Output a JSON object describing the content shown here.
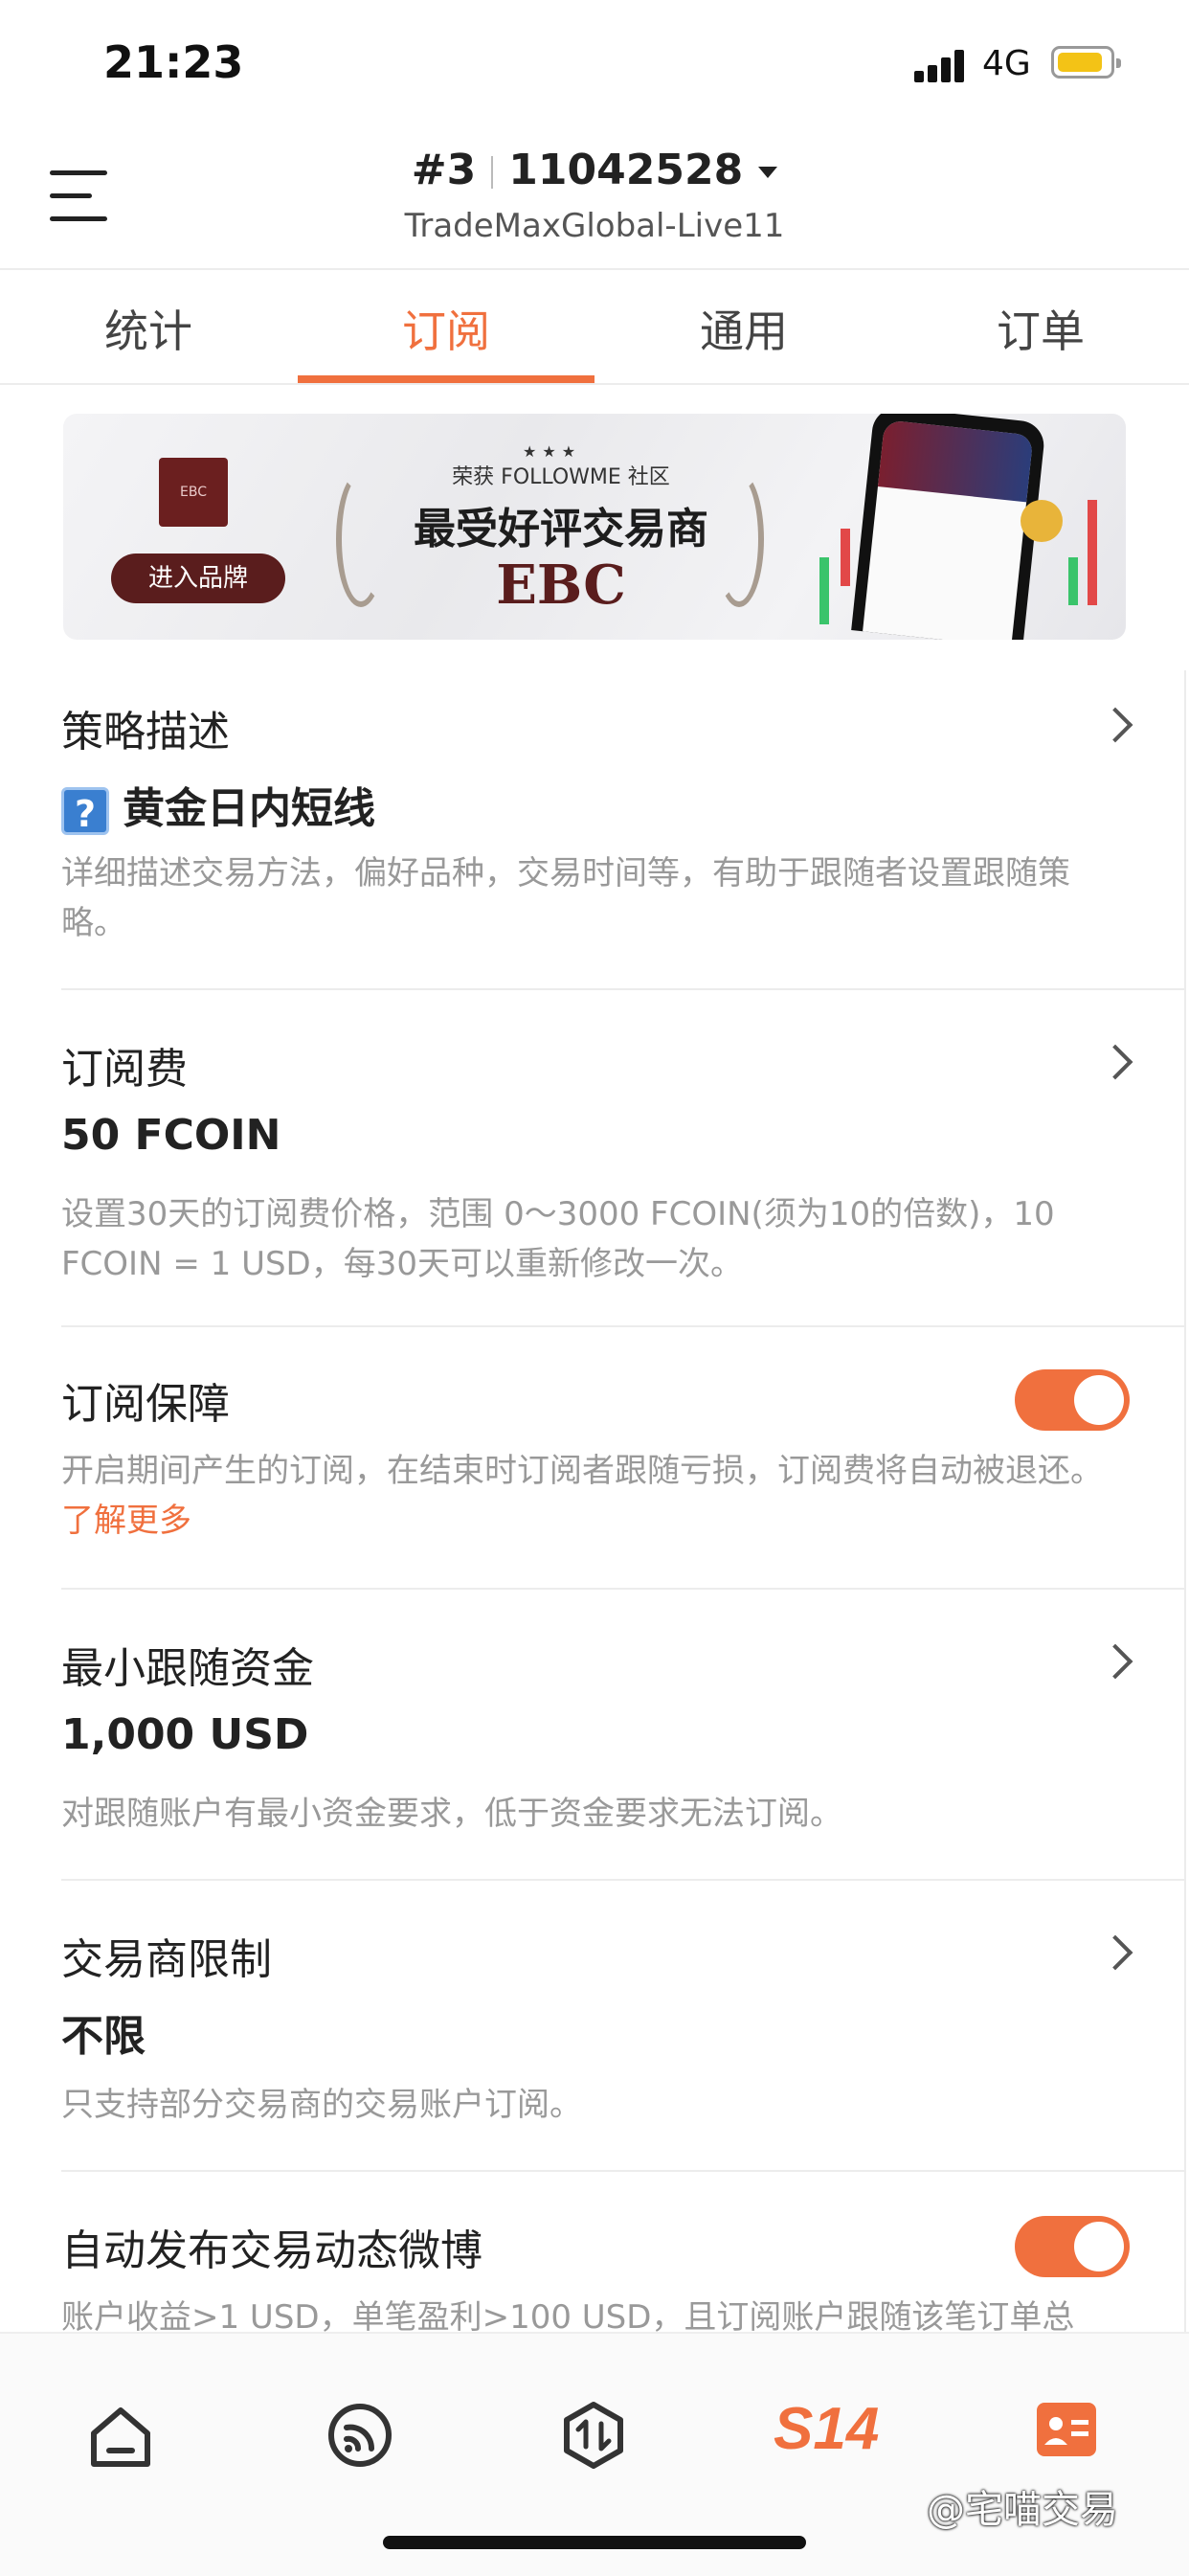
{
  "status_bar": {
    "time": "21:23",
    "network": "4G"
  },
  "header": {
    "account_rank": "#3",
    "account_number": "11042528",
    "server": "TradeMaxGlobal-Live11"
  },
  "tabs": [
    {
      "label": "统计",
      "active": false
    },
    {
      "label": "订阅",
      "active": true
    },
    {
      "label": "通用",
      "active": false
    },
    {
      "label": "订单",
      "active": false
    }
  ],
  "banner": {
    "subtitle": "荣获 FOLLOWME 社区",
    "title": "最受好评交易商",
    "brand": "EBC",
    "button_label": "进入品牌"
  },
  "sections": {
    "strategy": {
      "title": "策略描述",
      "value": "黄金日内短线",
      "description": "详细描述交易方法，偏好品种，交易时间等，有助于跟随者设置跟随策略。"
    },
    "subscription_fee": {
      "title": "订阅费",
      "value": "50 FCOIN",
      "description": "设置30天的订阅费价格，范围 0～3000 FCOIN(须为10的倍数)，10 FCOIN = 1 USD，每30天可以重新修改一次。"
    },
    "protection": {
      "title": "订阅保障",
      "enabled": true,
      "description": "开启期间产生的订阅，在结束时订阅者跟随亏损，订阅费将自动被退还。",
      "link_text": "了解更多"
    },
    "min_funds": {
      "title": "最小跟随资金",
      "value": "1,000 USD",
      "description": "对跟随账户有最小资金要求，低于资金要求无法订阅。"
    },
    "broker_limit": {
      "title": "交易商限制",
      "value": "不限",
      "description": "只支持部分交易商的交易账户订阅。"
    },
    "auto_post": {
      "title": "自动发布交易动态微博",
      "enabled": true,
      "description": "账户收益>1 USD，单笔盈利>100 USD，且订阅账户跟随该笔订单总"
    }
  },
  "bottom_nav": {
    "items": [
      "home-icon",
      "feed-icon",
      "trade-icon",
      "s14-icon",
      "profile-icon"
    ],
    "s14_label": "S14"
  },
  "watermark": "@宅喵交易",
  "colors": {
    "accent": "#f0703e",
    "text": "#222222",
    "muted": "#999999"
  }
}
